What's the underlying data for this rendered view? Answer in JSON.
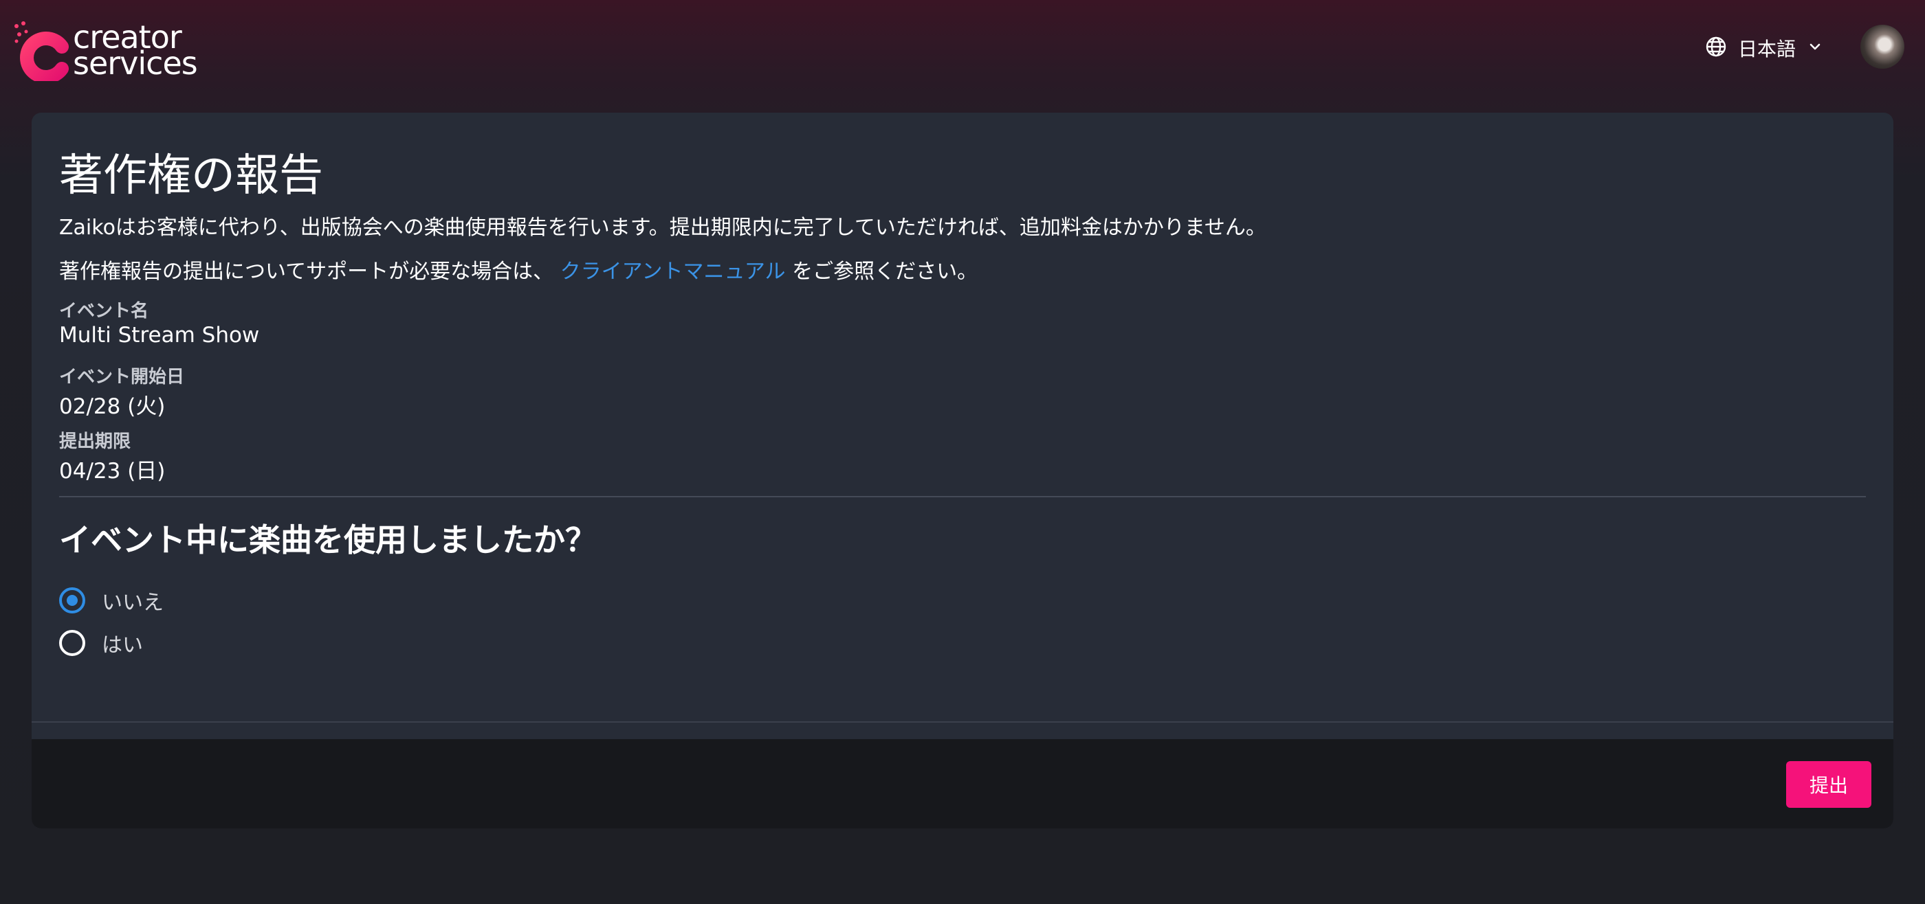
{
  "brand": {
    "logo_line1": "creator",
    "logo_line2": "services",
    "accent_color": "#f5127a",
    "link_color": "#3b93e6"
  },
  "header": {
    "language_label": "日本語",
    "language_icon": "globe-icon",
    "dropdown_icon": "chevron-down-icon"
  },
  "page": {
    "title": "著作権の報告",
    "description": "Zaikoはお客様に代わり、出版協会への楽曲使用報告を行います。提出期限内に完了していただければ、追加料金はかかりません。",
    "support_prefix": "著作権報告の提出についてサポートが必要な場合は、",
    "support_link": "クライアントマニュアル",
    "support_suffix": "をご参照ください。"
  },
  "event": {
    "name_label": "イベント名",
    "name_value": "Multi Stream Show",
    "start_label": "イベント開始日",
    "start_value": "02/28 (火)",
    "deadline_label": "提出期限",
    "deadline_value": "04/23 (日)"
  },
  "question": {
    "text": "イベント中に楽曲を使用しましたか？",
    "options": [
      {
        "label": "いいえ",
        "selected": true
      },
      {
        "label": "はい",
        "selected": false
      }
    ]
  },
  "footer": {
    "submit_label": "提出"
  }
}
